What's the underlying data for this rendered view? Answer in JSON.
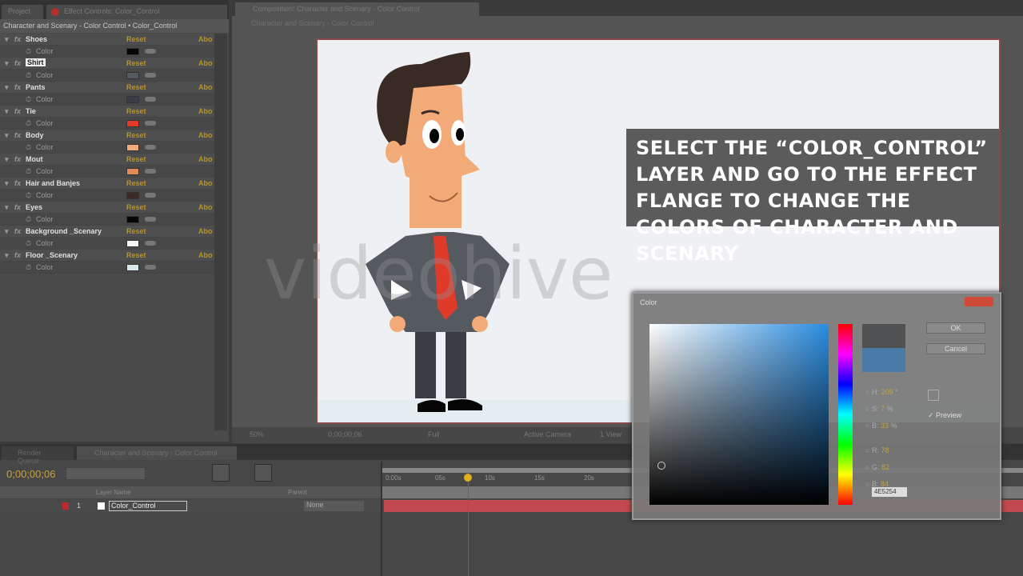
{
  "left_panel": {
    "tabs": [
      "Project",
      "Effect Controls: Color_Control"
    ],
    "header": "Character and Scenary - Color Control • Color_Control",
    "reset_label": "Reset",
    "about_label": "Abo",
    "effects": [
      {
        "name": "Shoes",
        "param": "Color",
        "color": "#050505"
      },
      {
        "name": "Shirt",
        "param": "Color",
        "color": "#555a60"
      },
      {
        "name": "Pants",
        "param": "Color",
        "color": "#3a3d45"
      },
      {
        "name": "Tie",
        "param": "Color",
        "color": "#e03a2a"
      },
      {
        "name": "Body",
        "param": "Color",
        "color": "#f2aa78"
      },
      {
        "name": "Mout",
        "param": "Color",
        "color": "#e08a5a"
      },
      {
        "name": "Hair and Banjes",
        "param": "Color",
        "color": "#3a2a24"
      },
      {
        "name": "Eyes",
        "param": "Color",
        "color": "#050505"
      },
      {
        "name": "Background _Scenary",
        "param": "Color",
        "color": "#f4f4f4"
      },
      {
        "name": "Floor _Scenary",
        "param": "Color",
        "color": "#d8e8ea"
      }
    ]
  },
  "viewer": {
    "tab": "Composition: Character and Scenary - Color Control",
    "breadcrumb": "Character and Scenary - Color Control",
    "caption": "Select the “Color_Control” layer and go to the Effect Flange to change the colors of character and scenary",
    "watermark": "videohive",
    "bottom_bar": {
      "zoom": "50%",
      "time": "0;00;00;06",
      "resolution": "Full",
      "camera": "Active Camera",
      "views": "1 View"
    }
  },
  "timeline": {
    "tabs": [
      "Render Queue",
      "Character and Scenary - Color Control"
    ],
    "timecode": "0;00;00;06",
    "search_placeholder": "",
    "col_layer_name": "Layer Name",
    "col_parent": "Parent",
    "ruler": [
      "0:00s",
      "05s",
      "10s",
      "15s",
      "20s"
    ],
    "layers": [
      {
        "index": "1",
        "name": "Color_Control",
        "parent": "None",
        "label_color": "#c0282a"
      }
    ]
  },
  "color_dialog": {
    "title": "Color",
    "ok": "OK",
    "cancel": "Cancel",
    "preview": "Preview",
    "fields": [
      {
        "k": "H",
        "v": "209",
        "u": "°"
      },
      {
        "k": "S",
        "v": "7",
        "u": "%"
      },
      {
        "k": "B",
        "v": "33",
        "u": "%"
      },
      {
        "k": "R",
        "v": "78"
      },
      {
        "k": "G",
        "v": "82"
      },
      {
        "k": "B",
        "v": "84"
      }
    ],
    "hex": "4E5254",
    "current_color": "#505152",
    "new_color": "#4a7aa8"
  }
}
